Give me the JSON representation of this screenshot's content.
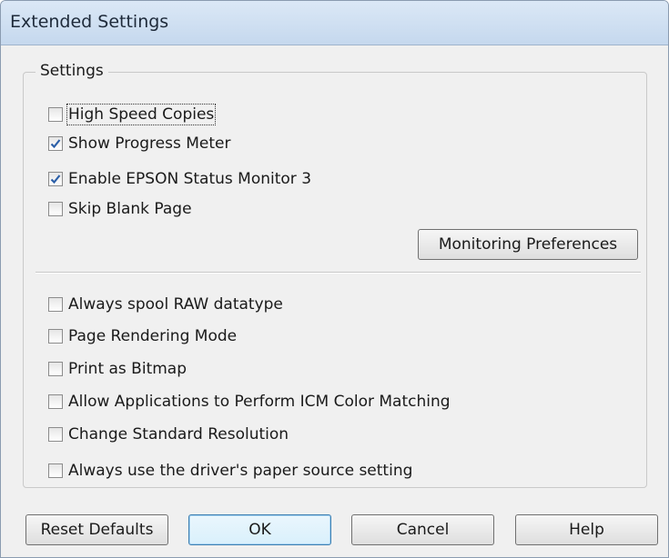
{
  "window": {
    "title": "Extended Settings"
  },
  "settings_group": {
    "label": "Settings",
    "options": [
      {
        "label": "High Speed Copies",
        "checked": false,
        "focused": true
      },
      {
        "label": "Show Progress Meter",
        "checked": true
      },
      {
        "label": "Enable EPSON Status Monitor 3",
        "checked": true
      },
      {
        "label": "Skip Blank Page",
        "checked": false
      }
    ],
    "monitoring_button": "Monitoring Preferences",
    "advanced_options": [
      {
        "label": "Always spool RAW datatype",
        "checked": false
      },
      {
        "label": "Page Rendering Mode",
        "checked": false
      },
      {
        "label": "Print as Bitmap",
        "checked": false
      },
      {
        "label": "Allow Applications to Perform ICM Color Matching",
        "checked": false
      },
      {
        "label": "Change Standard Resolution",
        "checked": false
      },
      {
        "label": "Always use the driver's paper source setting",
        "checked": false
      }
    ]
  },
  "buttons": {
    "reset": "Reset Defaults",
    "ok": "OK",
    "cancel": "Cancel",
    "help": "Help"
  },
  "colors": {
    "titlebar": "#c5d8ee",
    "dialog_bg": "#f0f0f0",
    "checkmark": "#2b5fa8",
    "default_button_border": "#3c7fb1"
  }
}
